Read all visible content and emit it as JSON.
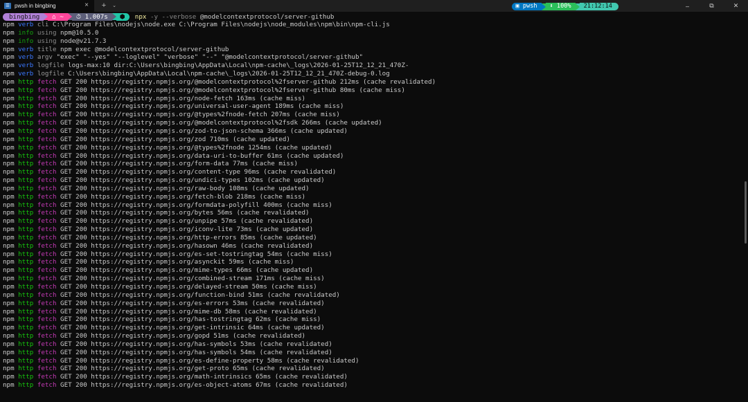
{
  "window": {
    "tab_title": "pwsh in bingbing",
    "tab_icon_glyph": "☰",
    "close_glyph": "×",
    "new_tab_glyph": "+",
    "dropdown_glyph": "⌄",
    "minimize_glyph": "–",
    "maximize_glyph": "⧉",
    "close_window_glyph": "✕"
  },
  "prompt": {
    "user": "bingbing",
    "path": "⌂ ~",
    "duration": "⏱ 1.007s",
    "node_glyph": "⬢",
    "command": "npx",
    "args": " -y --verbose",
    "package": " @modelcontextprotocol/server-github",
    "shell": "▣ pwsh",
    "battery": "⬍ 100%",
    "clock": "21:12:14"
  },
  "colors": {
    "info": "#13a10e",
    "verb": "#3b78ff",
    "http": "#16c60c",
    "fetch": "#c239b3"
  },
  "lines": [
    {
      "level": "verb",
      "tag": "cli",
      "text": "C:\\Program Files\\nodejs\\node.exe C:\\Program Files\\nodejs\\node_modules\\npm\\bin\\npm-cli.js"
    },
    {
      "level": "info",
      "tag": "using",
      "text": "npm@10.5.0"
    },
    {
      "level": "info",
      "tag": "using",
      "text": "node@v21.7.3"
    },
    {
      "level": "verb",
      "tag": "title",
      "text": "npm exec @modelcontextprotocol/server-github"
    },
    {
      "level": "verb",
      "tag": "argv",
      "text": "\"exec\" \"--yes\" \"--loglevel\" \"verbose\" \"--\" \"@modelcontextprotocol/server-github\""
    },
    {
      "level": "verb",
      "tag": "logfile",
      "text": "logs-max:10 dir:C:\\Users\\bingbing\\AppData\\Local\\npm-cache\\_logs\\2026-01-25T12_12_21_470Z-"
    },
    {
      "level": "verb",
      "tag": "logfile",
      "text": "C:\\Users\\bingbing\\AppData\\Local\\npm-cache\\_logs\\2026-01-25T12_12_21_470Z-debug-0.log"
    },
    {
      "level": "http",
      "tag": "fetch",
      "text": "GET 200 https://registry.npmjs.org/@modelcontextprotocol%2fserver-github 212ms (cache revalidated)"
    },
    {
      "level": "http",
      "tag": "fetch",
      "text": "GET 200 https://registry.npmjs.org/@modelcontextprotocol%2fserver-github 80ms (cache miss)"
    },
    {
      "level": "http",
      "tag": "fetch",
      "text": "GET 200 https://registry.npmjs.org/node-fetch 163ms (cache miss)"
    },
    {
      "level": "http",
      "tag": "fetch",
      "text": "GET 200 https://registry.npmjs.org/universal-user-agent 189ms (cache miss)"
    },
    {
      "level": "http",
      "tag": "fetch",
      "text": "GET 200 https://registry.npmjs.org/@types%2fnode-fetch 207ms (cache miss)"
    },
    {
      "level": "http",
      "tag": "fetch",
      "text": "GET 200 https://registry.npmjs.org/@modelcontextprotocol%2fsdk 266ms (cache updated)"
    },
    {
      "level": "http",
      "tag": "fetch",
      "text": "GET 200 https://registry.npmjs.org/zod-to-json-schema 366ms (cache updated)"
    },
    {
      "level": "http",
      "tag": "fetch",
      "text": "GET 200 https://registry.npmjs.org/zod 710ms (cache updated)"
    },
    {
      "level": "http",
      "tag": "fetch",
      "text": "GET 200 https://registry.npmjs.org/@types%2fnode 1254ms (cache updated)"
    },
    {
      "level": "http",
      "tag": "fetch",
      "text": "GET 200 https://registry.npmjs.org/data-uri-to-buffer 61ms (cache updated)"
    },
    {
      "level": "http",
      "tag": "fetch",
      "text": "GET 200 https://registry.npmjs.org/form-data 77ms (cache miss)"
    },
    {
      "level": "http",
      "tag": "fetch",
      "text": "GET 200 https://registry.npmjs.org/content-type 96ms (cache revalidated)"
    },
    {
      "level": "http",
      "tag": "fetch",
      "text": "GET 200 https://registry.npmjs.org/undici-types 102ms (cache updated)"
    },
    {
      "level": "http",
      "tag": "fetch",
      "text": "GET 200 https://registry.npmjs.org/raw-body 108ms (cache updated)"
    },
    {
      "level": "http",
      "tag": "fetch",
      "text": "GET 200 https://registry.npmjs.org/fetch-blob 218ms (cache miss)"
    },
    {
      "level": "http",
      "tag": "fetch",
      "text": "GET 200 https://registry.npmjs.org/formdata-polyfill 400ms (cache miss)"
    },
    {
      "level": "http",
      "tag": "fetch",
      "text": "GET 200 https://registry.npmjs.org/bytes 56ms (cache revalidated)"
    },
    {
      "level": "http",
      "tag": "fetch",
      "text": "GET 200 https://registry.npmjs.org/unpipe 57ms (cache revalidated)"
    },
    {
      "level": "http",
      "tag": "fetch",
      "text": "GET 200 https://registry.npmjs.org/iconv-lite 73ms (cache updated)"
    },
    {
      "level": "http",
      "tag": "fetch",
      "text": "GET 200 https://registry.npmjs.org/http-errors 85ms (cache updated)"
    },
    {
      "level": "http",
      "tag": "fetch",
      "text": "GET 200 https://registry.npmjs.org/hasown 46ms (cache revalidated)"
    },
    {
      "level": "http",
      "tag": "fetch",
      "text": "GET 200 https://registry.npmjs.org/es-set-tostringtag 54ms (cache miss)"
    },
    {
      "level": "http",
      "tag": "fetch",
      "text": "GET 200 https://registry.npmjs.org/asynckit 59ms (cache miss)"
    },
    {
      "level": "http",
      "tag": "fetch",
      "text": "GET 200 https://registry.npmjs.org/mime-types 66ms (cache updated)"
    },
    {
      "level": "http",
      "tag": "fetch",
      "text": "GET 200 https://registry.npmjs.org/combined-stream 171ms (cache miss)"
    },
    {
      "level": "http",
      "tag": "fetch",
      "text": "GET 200 https://registry.npmjs.org/delayed-stream 50ms (cache miss)"
    },
    {
      "level": "http",
      "tag": "fetch",
      "text": "GET 200 https://registry.npmjs.org/function-bind 51ms (cache revalidated)"
    },
    {
      "level": "http",
      "tag": "fetch",
      "text": "GET 200 https://registry.npmjs.org/es-errors 53ms (cache revalidated)"
    },
    {
      "level": "http",
      "tag": "fetch",
      "text": "GET 200 https://registry.npmjs.org/mime-db 58ms (cache revalidated)"
    },
    {
      "level": "http",
      "tag": "fetch",
      "text": "GET 200 https://registry.npmjs.org/has-tostringtag 62ms (cache miss)"
    },
    {
      "level": "http",
      "tag": "fetch",
      "text": "GET 200 https://registry.npmjs.org/get-intrinsic 64ms (cache updated)"
    },
    {
      "level": "http",
      "tag": "fetch",
      "text": "GET 200 https://registry.npmjs.org/gopd 51ms (cache revalidated)"
    },
    {
      "level": "http",
      "tag": "fetch",
      "text": "GET 200 https://registry.npmjs.org/has-symbols 53ms (cache revalidated)"
    },
    {
      "level": "http",
      "tag": "fetch",
      "text": "GET 200 https://registry.npmjs.org/has-symbols 54ms (cache revalidated)"
    },
    {
      "level": "http",
      "tag": "fetch",
      "text": "GET 200 https://registry.npmjs.org/es-define-property 58ms (cache revalidated)"
    },
    {
      "level": "http",
      "tag": "fetch",
      "text": "GET 200 https://registry.npmjs.org/get-proto 65ms (cache revalidated)"
    },
    {
      "level": "http",
      "tag": "fetch",
      "text": "GET 200 https://registry.npmjs.org/math-intrinsics 65ms (cache revalidated)"
    },
    {
      "level": "http",
      "tag": "fetch",
      "text": "GET 200 https://registry.npmjs.org/es-object-atoms 67ms (cache revalidated)"
    }
  ]
}
